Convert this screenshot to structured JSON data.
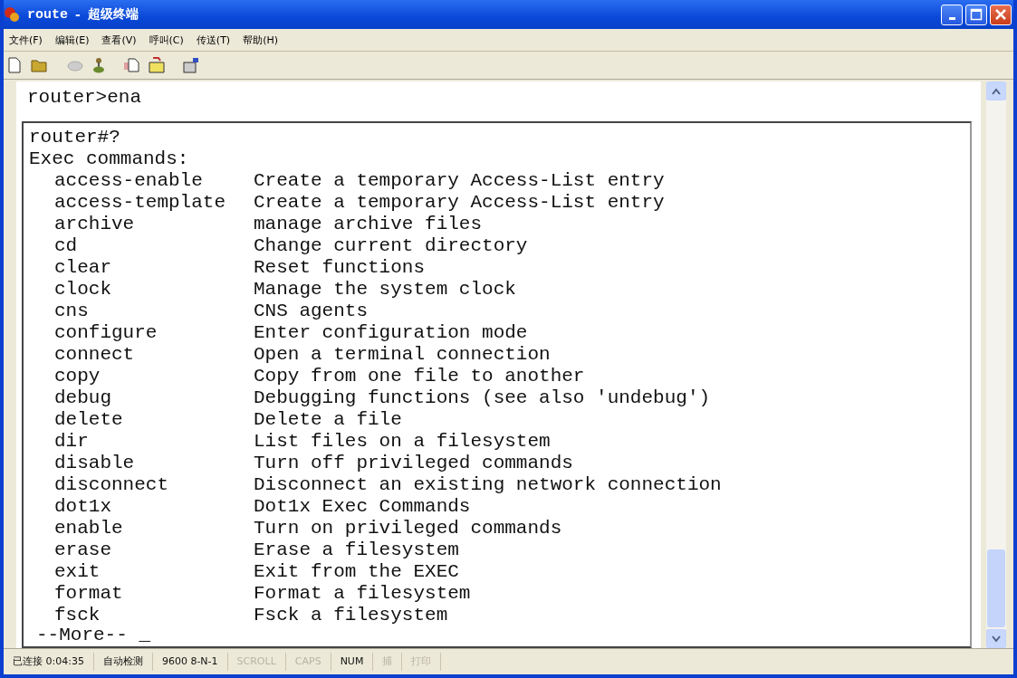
{
  "window": {
    "title_name": "route",
    "separator": "-",
    "title_app": "超级终端"
  },
  "menu": [
    "文件(F)",
    "编辑(E)",
    "查看(V)",
    "呼叫(C)",
    "传送(T)",
    "帮助(H)"
  ],
  "terminal": {
    "top_line": "router>ena",
    "prompt": "router#?",
    "heading": "Exec commands:",
    "commands": [
      {
        "name": "access-enable",
        "description": "Create a temporary Access-List entry"
      },
      {
        "name": "access-template",
        "description": "Create a temporary Access-List entry"
      },
      {
        "name": "archive",
        "description": "manage archive files"
      },
      {
        "name": "cd",
        "description": "Change current directory"
      },
      {
        "name": "clear",
        "description": "Reset functions"
      },
      {
        "name": "clock",
        "description": "Manage the system clock"
      },
      {
        "name": "cns",
        "description": "CNS agents"
      },
      {
        "name": "configure",
        "description": "Enter configuration mode"
      },
      {
        "name": "connect",
        "description": "Open a terminal connection"
      },
      {
        "name": "copy",
        "description": "Copy from one file to another"
      },
      {
        "name": "debug",
        "description": "Debugging functions (see also 'undebug')"
      },
      {
        "name": "delete",
        "description": "Delete a file"
      },
      {
        "name": "dir",
        "description": "List files on a filesystem"
      },
      {
        "name": "disable",
        "description": "Turn off privileged commands"
      },
      {
        "name": "disconnect",
        "description": "Disconnect an existing network connection"
      },
      {
        "name": "dot1x",
        "description": "Dot1x Exec Commands"
      },
      {
        "name": "enable",
        "description": "Turn on privileged commands"
      },
      {
        "name": "erase",
        "description": "Erase a filesystem"
      },
      {
        "name": "exit",
        "description": "Exit from the EXEC"
      },
      {
        "name": "format",
        "description": "Format a filesystem"
      },
      {
        "name": "fsck",
        "description": "Fsck a filesystem"
      }
    ],
    "more": "--More-- _"
  },
  "status_bar": [
    {
      "text": "已连接 0:04:35",
      "disabled": false
    },
    {
      "text": "自动检测",
      "disabled": false
    },
    {
      "text": "9600 8-N-1",
      "disabled": false
    },
    {
      "text": "SCROLL",
      "disabled": true
    },
    {
      "text": "CAPS",
      "disabled": true
    },
    {
      "text": "NUM",
      "disabled": false
    },
    {
      "text": "捕",
      "disabled": true
    },
    {
      "text": "打印",
      "disabled": true
    }
  ]
}
